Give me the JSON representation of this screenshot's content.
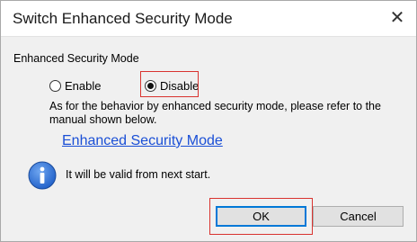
{
  "window": {
    "title": "Switch Enhanced Security Mode",
    "close_glyph": "✕"
  },
  "mode_group": {
    "label": "Enhanced Security Mode",
    "options": [
      {
        "label": "Enable",
        "selected": false
      },
      {
        "label": "Disable",
        "selected": true
      }
    ]
  },
  "description": "As for the behavior by enhanced security mode, please refer to the manual shown below.",
  "manual_link": "Enhanced Security Mode",
  "info": {
    "icon": "info-icon",
    "text": "It will be valid from next start."
  },
  "buttons": {
    "ok_label": "OK",
    "cancel_label": "Cancel"
  },
  "colors": {
    "highlight": "#d9332f",
    "link": "#1a4fd6",
    "info_icon": "#1f5fc8"
  }
}
